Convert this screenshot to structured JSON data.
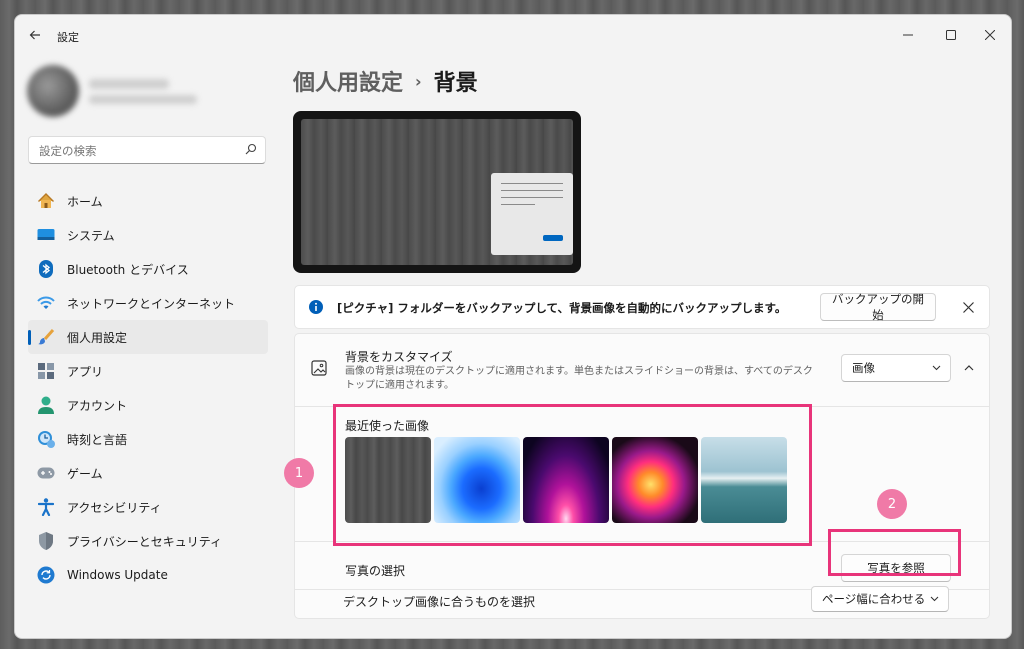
{
  "window": {
    "title": "設定"
  },
  "search": {
    "placeholder": "設定の検索"
  },
  "sidebar": {
    "items": [
      {
        "label": "ホーム",
        "icon": "home-icon"
      },
      {
        "label": "システム",
        "icon": "system-icon"
      },
      {
        "label": "Bluetooth とデバイス",
        "icon": "bluetooth-icon"
      },
      {
        "label": "ネットワークとインターネット",
        "icon": "wifi-icon"
      },
      {
        "label": "個人用設定",
        "icon": "brush-icon",
        "active": true
      },
      {
        "label": "アプリ",
        "icon": "apps-icon"
      },
      {
        "label": "アカウント",
        "icon": "account-icon"
      },
      {
        "label": "時刻と言語",
        "icon": "time-language-icon"
      },
      {
        "label": "ゲーム",
        "icon": "game-icon"
      },
      {
        "label": "アクセシビリティ",
        "icon": "accessibility-icon"
      },
      {
        "label": "プライバシーとセキュリティ",
        "icon": "shield-icon"
      },
      {
        "label": "Windows Update",
        "icon": "update-icon"
      }
    ]
  },
  "breadcrumb": {
    "parent": "個人用設定",
    "separator": "›",
    "current": "背景"
  },
  "banner": {
    "text": "[ピクチャ] フォルダーをバックアップして、背景画像を自動的にバックアップします。",
    "button": "バックアップの開始"
  },
  "customize": {
    "title": "背景をカスタマイズ",
    "description": "画像の背景は現在のデスクトップに適用されます。単色またはスライドショーの背景は、すべてのデスクトップに適用されます。",
    "dropdown_value": "画像",
    "recent_label": "最近使った画像",
    "photo_label": "写真の選択",
    "browse_button": "写真を参照",
    "fit_label": "デスクトップ画像に合うものを選択",
    "fit_value": "ページ幅に合わせる"
  },
  "annotations": {
    "badge1": "1",
    "badge2": "2"
  },
  "colors": {
    "accent": "#005fb8",
    "highlight": "#e8347a",
    "badge": "#f07aa7"
  }
}
